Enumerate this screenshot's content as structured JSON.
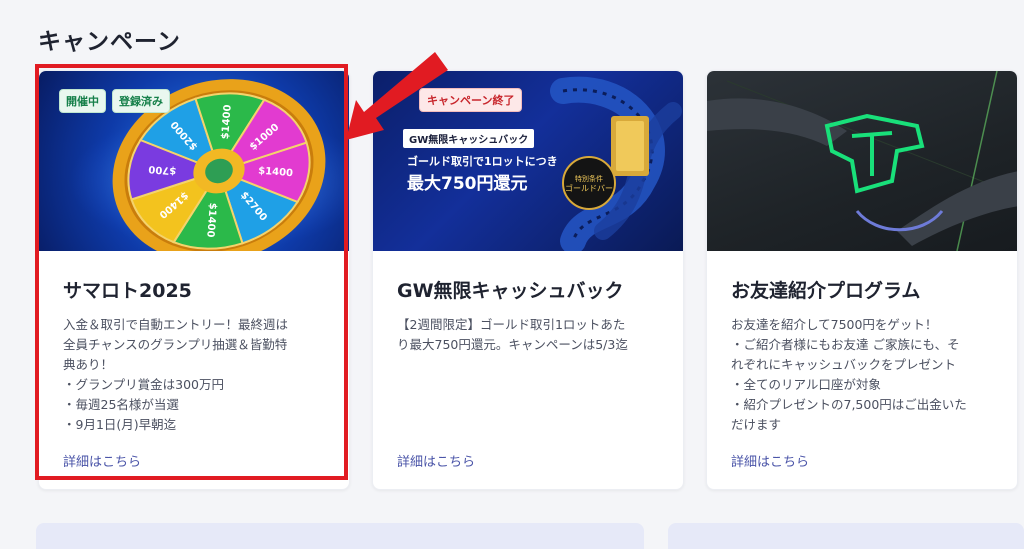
{
  "page": {
    "title": "キャンペーン"
  },
  "cards": [
    {
      "title": "サマロト2025",
      "badges": [
        "開催中",
        "登録済み"
      ],
      "description": [
        "入金＆取引で自動エントリー！最終週は",
        "全員チャンスのグランプリ抽選＆皆勤特",
        "典あり！",
        "・グランプリ賞金は300万円",
        "・毎週25名様が当選",
        "・9月1日(月)早朝迄"
      ],
      "link": "詳細はこちら"
    },
    {
      "title": "GW無限キャッシュバック",
      "status_badge": "キャンペーン終了",
      "banner_tag": "GW無限キャッシュバック",
      "banner_line1": "ゴールド取引で1ロットにつき",
      "banner_line2": "最大750円還元",
      "description": [
        "【2週間限定】ゴールド取引1ロットあた",
        "り最大750円還元。キャンペーンは5/3迄"
      ],
      "link": "詳細はこちら"
    },
    {
      "title": "お友達紹介プログラム",
      "description": [
        "お友達を紹介して7500円をゲット！",
        "・ご紹介者様にもお友達 ご家族にも、そ",
        "れぞれにキャッシュバックをプレゼント",
        "・全てのリアル口座が対象",
        "・紹介プレゼントの7,500円はご出金いた",
        "だけます"
      ],
      "link": "詳細はこちら"
    }
  ],
  "wheel_labels": [
    "$1400",
    "$2700",
    "$1400",
    "$1400",
    "$700",
    "$2000",
    "$1400",
    "$1000"
  ],
  "colors": {
    "highlight": "#e11b22",
    "link": "#4a54a8",
    "badge_green": "#16804a",
    "badge_red": "#c8262c"
  }
}
